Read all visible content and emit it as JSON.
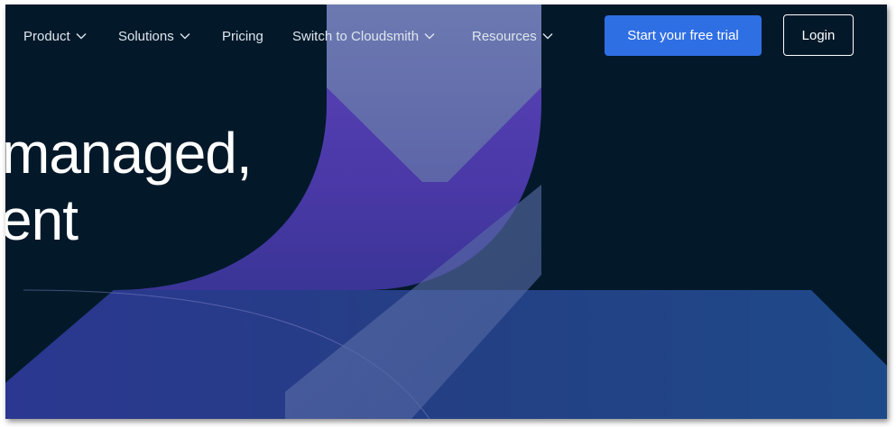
{
  "nav": {
    "items": [
      {
        "label": "Product",
        "has_dropdown": true
      },
      {
        "label": "Solutions",
        "has_dropdown": true
      },
      {
        "label": "Pricing",
        "has_dropdown": false
      },
      {
        "label": "Switch to Cloudsmith",
        "has_dropdown": true
      },
      {
        "label": "Resources",
        "has_dropdown": true
      }
    ],
    "cta_label": "Start your free trial",
    "login_label": "Login"
  },
  "hero": {
    "line1": "managed,",
    "line2": "ent"
  },
  "colors": {
    "background": "#03192a",
    "accent": "#2f6fe4",
    "purple": "#5a3fb8",
    "nav_text": "#dfe6ee"
  },
  "icons": [
    "chevron-down-icon"
  ]
}
